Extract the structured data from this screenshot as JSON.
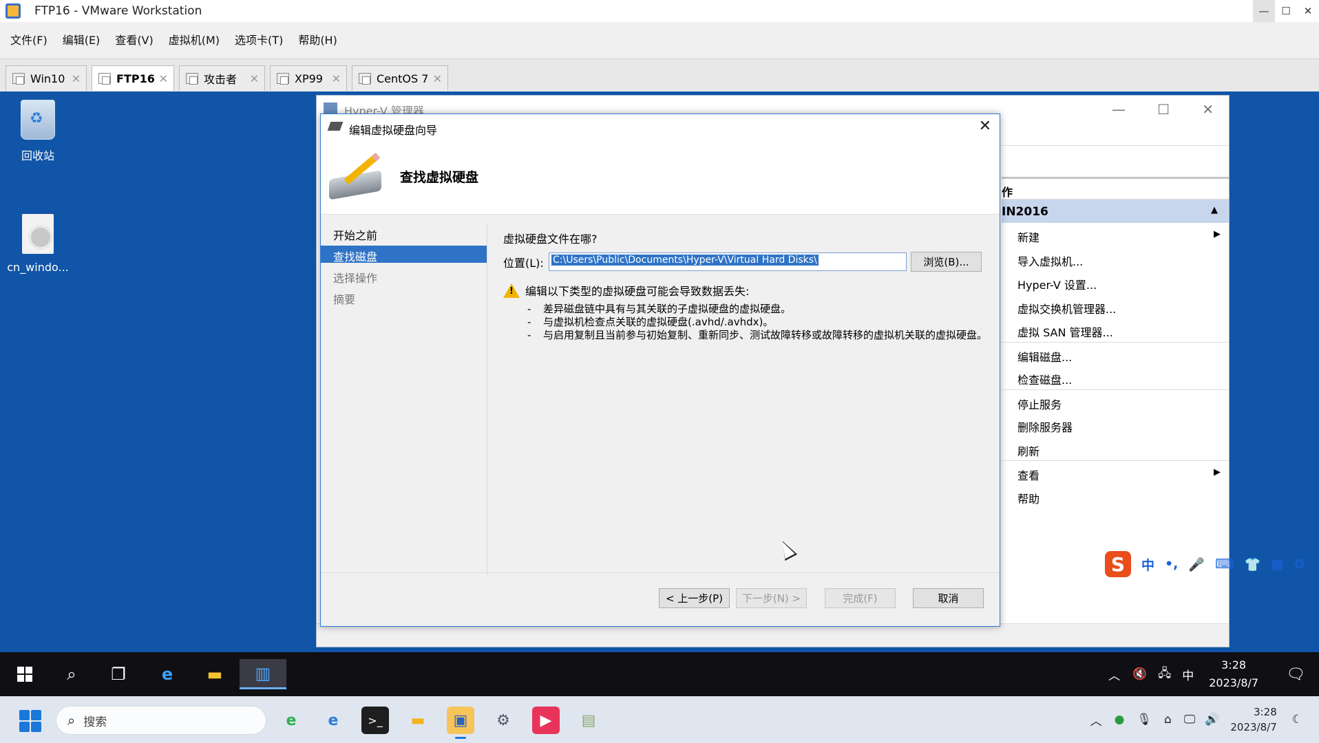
{
  "host": {
    "title": "FTP16 - VMware Workstation",
    "menu": [
      "文件(F)",
      "编辑(E)",
      "查看(V)",
      "虚拟机(M)",
      "选项卡(T)",
      "帮助(H)"
    ],
    "tabs": [
      {
        "label": "Win10",
        "active": false
      },
      {
        "label": "FTP16",
        "active": true
      },
      {
        "label": "攻击者",
        "active": false
      },
      {
        "label": "XP99",
        "active": false
      },
      {
        "label": "CentOS 7",
        "active": false
      }
    ]
  },
  "desktop": {
    "icons": [
      {
        "label": "回收站",
        "icon": "recycle-bin-icon"
      },
      {
        "label": "cn_windo...",
        "icon": "iso-disc-icon"
      }
    ]
  },
  "hyperv": {
    "title": "Hyper-V 管理器",
    "actions_header": "作",
    "server_group": "IN2016",
    "actions": [
      {
        "label": "新建",
        "submenu": true
      },
      {
        "label": "导入虚拟机..."
      },
      {
        "label": "Hyper-V 设置..."
      },
      {
        "label": "虚拟交换机管理器..."
      },
      {
        "label": "虚拟 SAN 管理器..."
      },
      {
        "label": "编辑磁盘..."
      },
      {
        "label": "检查磁盘..."
      },
      {
        "label": "停止服务"
      },
      {
        "label": "删除服务器"
      },
      {
        "label": "刷新"
      },
      {
        "label": "查看",
        "submenu": true
      },
      {
        "label": "帮助"
      }
    ]
  },
  "wizard": {
    "title": "编辑虚拟硬盘向导",
    "heading": "查找虚拟硬盘",
    "nav": [
      {
        "label": "开始之前",
        "state": "normal"
      },
      {
        "label": "查找磁盘",
        "state": "active"
      },
      {
        "label": "选择操作",
        "state": "dim"
      },
      {
        "label": "摘要",
        "state": "dim"
      }
    ],
    "question": "虚拟硬盘文件在哪?",
    "location_label": "位置(L):",
    "location_value": "C:\\Users\\Public\\Documents\\Hyper-V\\Virtual Hard Disks\\",
    "browse_label": "浏览(B)...",
    "warning_title": "编辑以下类型的虚拟硬盘可能会导致数据丢失:",
    "warning_items": [
      "差异磁盘链中具有与其关联的子虚拟硬盘的虚拟硬盘。",
      "与虚拟机检查点关联的虚拟硬盘(.avhd/.avhdx)。",
      "与启用复制且当前参与初始复制、重新同步、测试故障转移或故障转移的虚拟机关联的虚拟硬盘。"
    ],
    "buttons": {
      "prev": "< 上一步(P)",
      "next": "下一步(N) >",
      "finish": "完成(F)",
      "cancel": "取消"
    }
  },
  "ime": {
    "logo": "S",
    "mode": "中",
    "punct": "•,"
  },
  "guest_taskbar": {
    "ime_indicator": "中",
    "time": "3:28",
    "date": "2023/8/7"
  },
  "host_taskbar": {
    "search_placeholder": "搜索",
    "time": "3:28",
    "date": "2023/8/7"
  },
  "colors": {
    "desktop": "#1055a8",
    "selection": "#2f73c6",
    "warning": "#f0b400"
  }
}
